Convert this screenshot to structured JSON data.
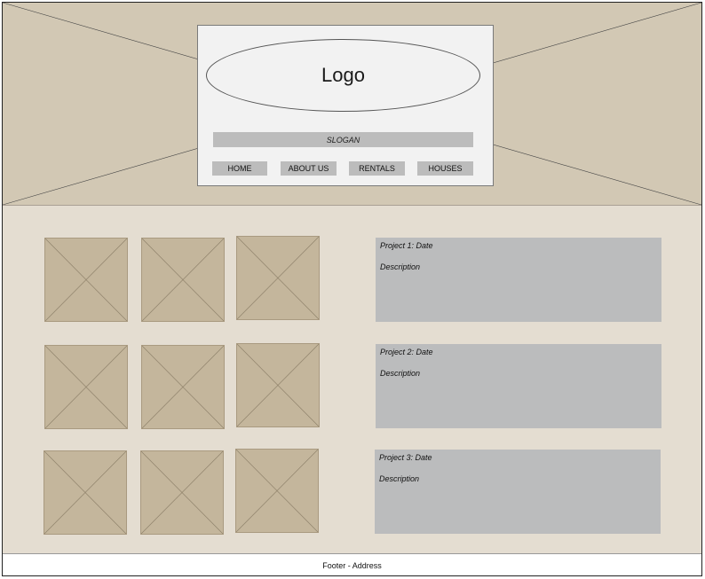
{
  "header": {
    "logo_text": "Logo",
    "slogan": "SLOGAN",
    "nav": [
      "HOME",
      "ABOUT US",
      "RENTALS",
      "HOUSES"
    ]
  },
  "gallery": {
    "rows": 3,
    "columns": 3
  },
  "projects": [
    {
      "title": "Project 1: Date",
      "description": "Description"
    },
    {
      "title": "Project 2: Date",
      "description": "Description"
    },
    {
      "title": "Project 3: Date",
      "description": "Description"
    }
  ],
  "footer": {
    "text": "Footer - Address"
  },
  "colors": {
    "hero_bg": "#d2c8b4",
    "content_bg": "#e4ddd1",
    "thumb_bg": "#c4b69c",
    "project_bg": "#bbbcbd",
    "nav_bg": "#bcbcbc"
  }
}
